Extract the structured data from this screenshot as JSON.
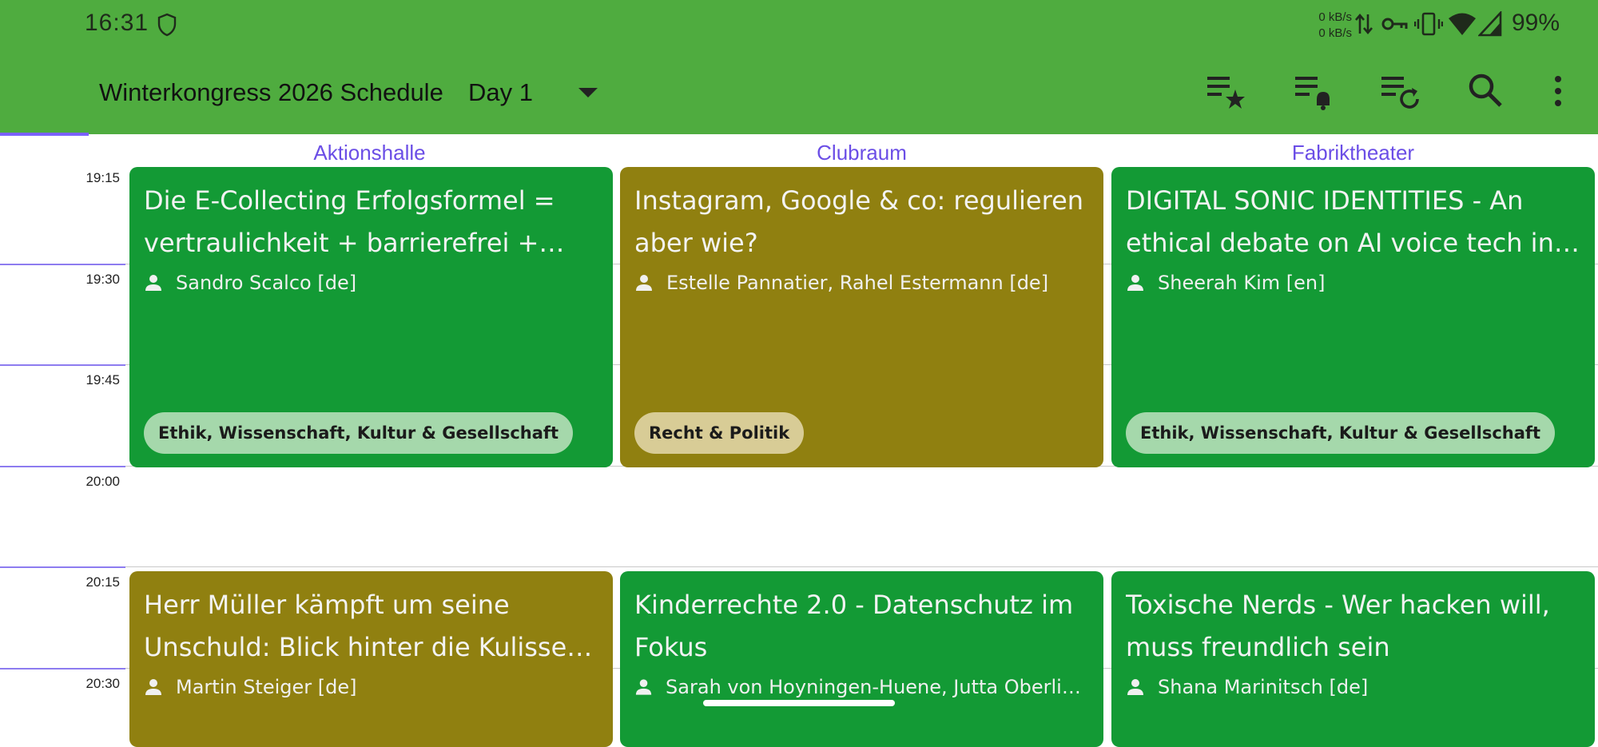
{
  "status_bar": {
    "time": "16:31",
    "net_up": "0 kB/s",
    "net_down": "0 kB/s",
    "battery": "99%",
    "icons": [
      "shield-icon",
      "data-arrows-icon",
      "vpn-key-icon",
      "vibrate-icon",
      "wifi-icon",
      "signal-icon"
    ]
  },
  "toolbar": {
    "title": "Winterkongress 2026 Schedule",
    "day": "Day 1",
    "actions": [
      "starred-list-icon",
      "alarms-list-icon",
      "refresh-list-icon",
      "search-icon",
      "more-vert-icon"
    ]
  },
  "rooms": [
    "Aktionshalle",
    "Clubraum",
    "Fabriktheater"
  ],
  "time_slots": [
    "19:15",
    "19:30",
    "19:45",
    "20:00",
    "20:15",
    "20:30"
  ],
  "sessions": [
    {
      "title": "Die E-Collecting Erfolgsformel = vertraulichkeit + barrierefrei + mehr…",
      "speakers": "Sandro Scalco [de]",
      "track": "Ethik, Wissenschaft, Kultur & Gesellschaft",
      "color": "#139a35"
    },
    {
      "title": "Instagram, Google & co: regulieren aber wie?",
      "speakers": "Estelle Pannatier, Rahel Estermann [de]",
      "track": "Recht & Politik",
      "color": "#908010"
    },
    {
      "title": "DIGITAL SONIC IDENTITIES - An ethical debate on AI voice tech in g…",
      "speakers": "Sheerah Kim [en]",
      "track": "Ethik, Wissenschaft, Kultur & Gesellschaft",
      "color": "#139a35"
    },
    {
      "title": "Herr Müller kämpft um seine Unschuld: Blick hinter die Kulissen …",
      "speakers": "Martin Steiger [de]",
      "color": "#908010"
    },
    {
      "title": "Kinderrechte 2.0 - Datenschutz im Fokus",
      "speakers": "Sarah von Hoyningen-Huene, Jutta Oberlin […",
      "color": "#139a35"
    },
    {
      "title": "Toxische Nerds - Wer hacken will, muss freundlich sein",
      "speakers": "Shana Marinitsch [de]",
      "color": "#139a35"
    }
  ]
}
